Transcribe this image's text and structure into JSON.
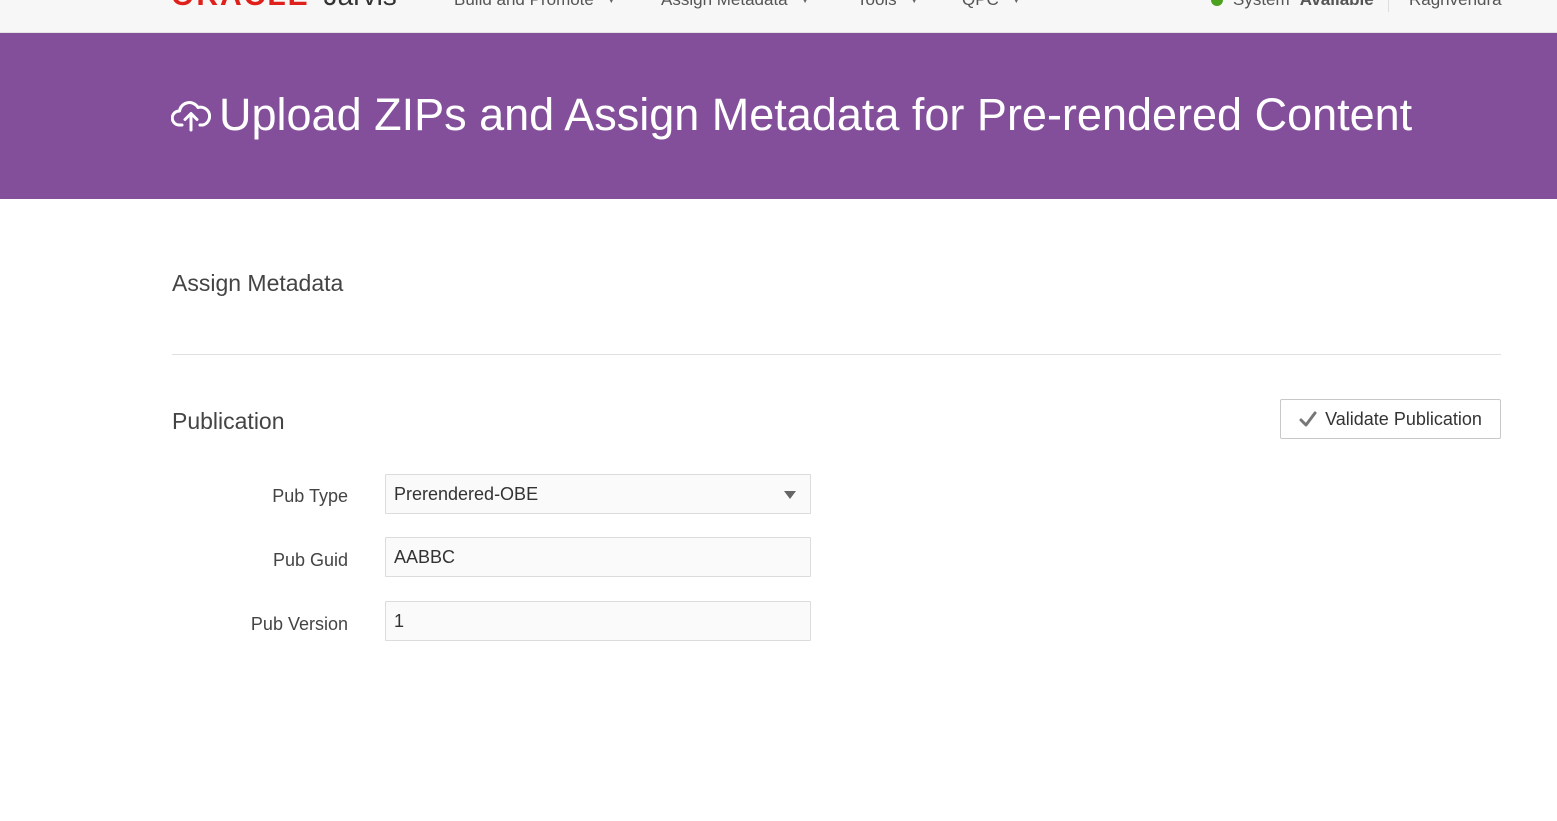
{
  "app": {
    "brand": "ORACLE",
    "name": "Jarvis"
  },
  "nav": {
    "items": [
      {
        "label": "Build and Promote"
      },
      {
        "label": "Assign Metadata"
      },
      {
        "label": "Tools"
      },
      {
        "label": "QPC"
      }
    ],
    "caret": "▼",
    "status_prefix": "System",
    "status_value": "Available",
    "status_color": "#4aa21e",
    "user": "Raghvendra"
  },
  "header": {
    "icon": "cloud-upload-icon",
    "title": "Upload ZIPs and Assign Metadata for Pre-rendered Content",
    "background": "#834f9a"
  },
  "main": {
    "section_title": "Assign Metadata",
    "publication_title": "Publication",
    "validate_label": "Validate Publication",
    "validate_icon": "checkmark-icon",
    "form": {
      "pub_type_label": "Pub Type",
      "pub_type_value": "Prerendered-OBE",
      "pub_guid_label": "Pub Guid",
      "pub_guid_value": "AABBC",
      "pub_version_label": "Pub Version",
      "pub_version_value": "1"
    }
  }
}
